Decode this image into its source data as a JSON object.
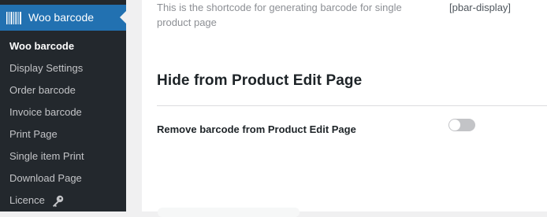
{
  "sidebar": {
    "menu_title": "Woo barcode",
    "menu_icon": "barcode-icon",
    "items": [
      {
        "label": "Woo barcode",
        "active": true
      },
      {
        "label": "Display Settings",
        "active": false
      },
      {
        "label": "Order barcode",
        "active": false
      },
      {
        "label": "Invoice barcode",
        "active": false
      },
      {
        "label": "Print Page",
        "active": false
      },
      {
        "label": "Single item Print",
        "active": false
      },
      {
        "label": "Download Page",
        "active": false
      },
      {
        "label": "Licence",
        "active": false,
        "icon": "key-icon"
      }
    ]
  },
  "content": {
    "shortcode_description": "This is the shortcode for generating barcode for single product page",
    "shortcode_value": "[pbar-display]",
    "section_title": "Hide from Product Edit Page",
    "field_label": "Remove barcode from Product Edit Page",
    "toggle_on": false
  },
  "colors": {
    "sidebar_bg": "#23282d",
    "accent": "#2271b1",
    "toggle_off": "#c3c4c7"
  }
}
